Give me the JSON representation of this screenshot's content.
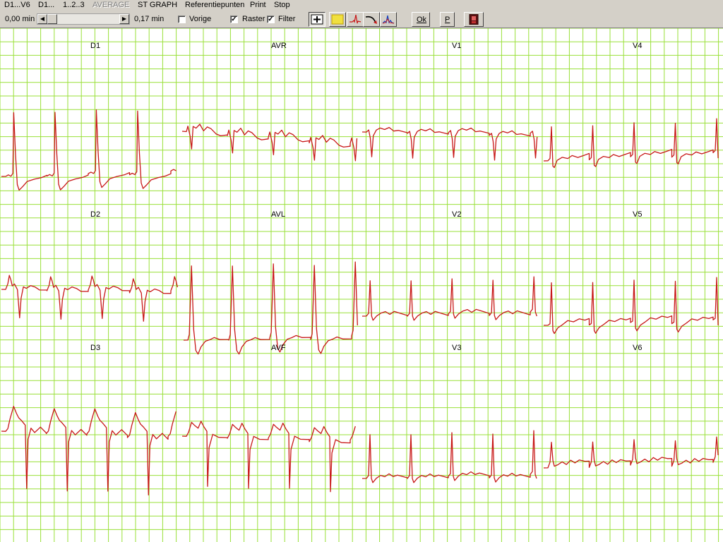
{
  "menu": {
    "items": [
      {
        "label": "D1...V6",
        "enabled": true
      },
      {
        "label": "D1...",
        "enabled": true
      },
      {
        "label": "1..2..3",
        "enabled": true
      },
      {
        "label": "AVERAGE",
        "enabled": false
      },
      {
        "label": "ST GRAPH",
        "enabled": true
      },
      {
        "label": "Referentiepunten",
        "enabled": true
      },
      {
        "label": "Print",
        "enabled": true
      },
      {
        "label": "Stop",
        "enabled": true
      }
    ]
  },
  "toolbar": {
    "start_time": "0,00 min",
    "end_time": "0,17 min",
    "scroll_position": 0.0,
    "vorige": {
      "label": "Vorige",
      "checked": false
    },
    "raster": {
      "label": "Raster",
      "checked": true
    },
    "filter": {
      "label": "Filter",
      "checked": true
    },
    "tool_icons": [
      "crosshair-icon",
      "raster-color-icon",
      "ecg-waveform-icon",
      "curve-measure-icon",
      "spectrum-icon"
    ],
    "ok_label": "Ok",
    "p_label": "P",
    "exit_icon": "door-exit-icon"
  },
  "colors": {
    "grid": "#99e038",
    "trace": "#c81818",
    "panel": "#d4d0c8",
    "raster_button": "#f0e040"
  },
  "ecg": {
    "leads": [
      {
        "name": "D1"
      },
      {
        "name": "AVR"
      },
      {
        "name": "V1"
      },
      {
        "name": "V4"
      },
      {
        "name": "D2"
      },
      {
        "name": "AVL"
      },
      {
        "name": "V2"
      },
      {
        "name": "V5"
      },
      {
        "name": "D3"
      },
      {
        "name": "AVF"
      },
      {
        "name": "V3"
      },
      {
        "name": "V6"
      }
    ]
  }
}
